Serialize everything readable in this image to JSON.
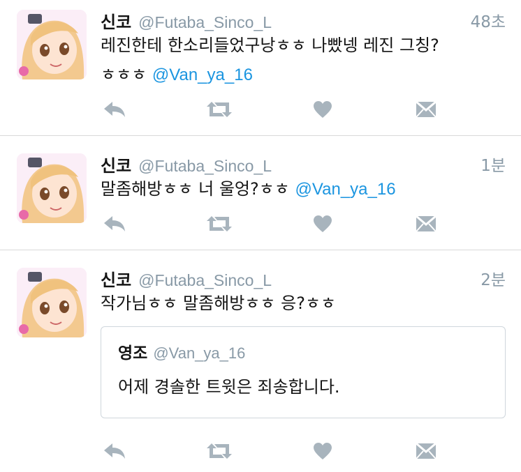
{
  "tweets": [
    {
      "name": "신코",
      "handle": "@Futaba_Sinco_L",
      "time": "48초",
      "text_line1": "레진한테 한소리들었구낭ㅎㅎ 나빴넹 레진 그칭?",
      "text_line2": "ㅎㅎㅎ",
      "mention": "@Van_ya_16"
    },
    {
      "name": "신코",
      "handle": "@Futaba_Sinco_L",
      "time": "1분",
      "text": "말좀해방ㅎㅎ 너 울엉?ㅎㅎ",
      "mention": "@Van_ya_16"
    },
    {
      "name": "신코",
      "handle": "@Futaba_Sinco_L",
      "time": "2분",
      "text": "작가님ㅎㅎ 말좀해방ㅎㅎ 응?ㅎㅎ",
      "quote": {
        "name": "영조",
        "handle": "@Van_ya_16",
        "text": "어제 경솔한 트윗은 죄송합니다."
      }
    }
  ],
  "icons": {
    "reply": "reply-icon",
    "retweet": "retweet-icon",
    "like": "heart-icon",
    "dm": "envelope-icon"
  },
  "colors": {
    "accent": "#1b95e0",
    "muted": "#8899a6",
    "icon": "#a8b4bd"
  }
}
